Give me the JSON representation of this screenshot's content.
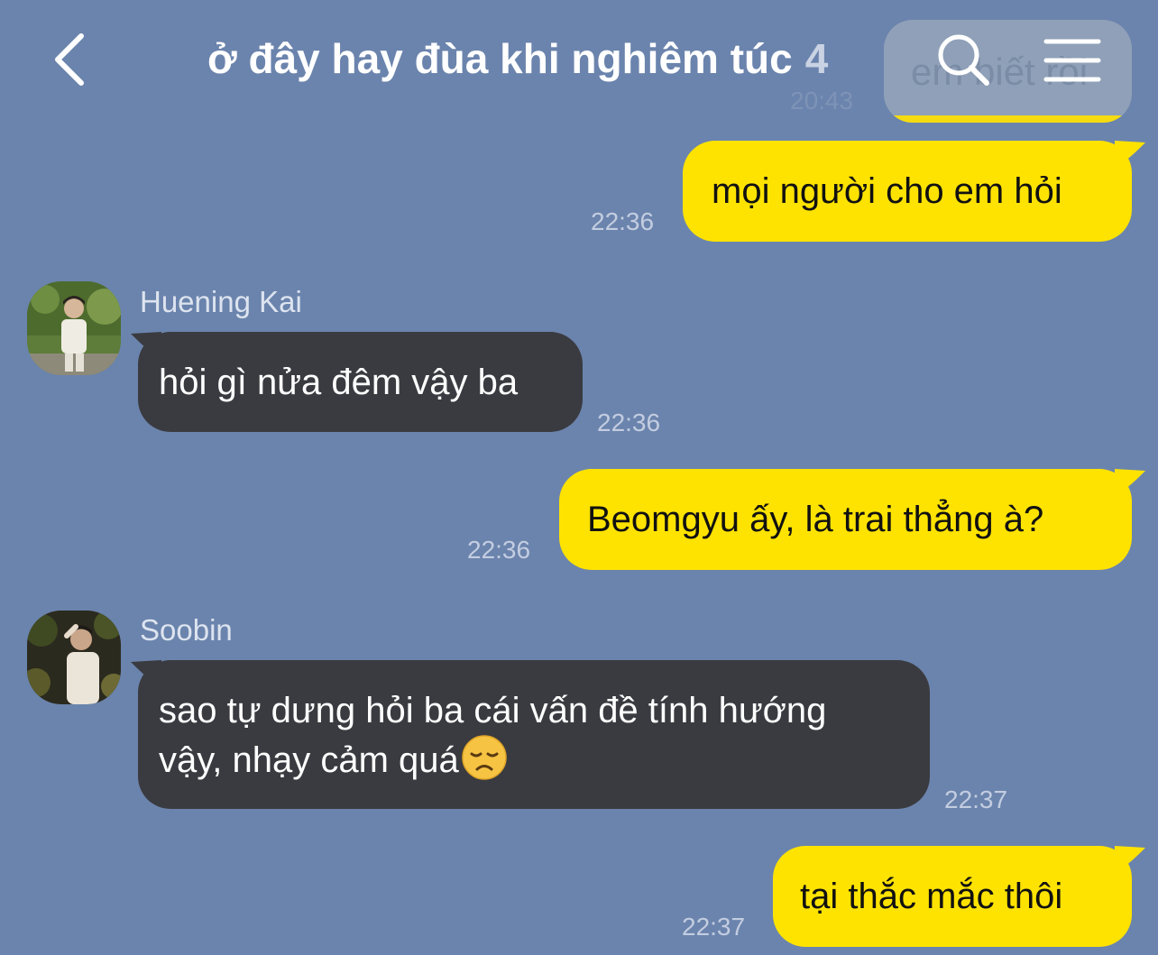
{
  "header": {
    "title": "ở đây hay đùa khi nghiêm túc",
    "member_count": "4",
    "back_icon": "chevron-left-icon",
    "search_icon": "search-icon",
    "menu_icon": "menu-icon"
  },
  "previous": {
    "text": "em biết rồi",
    "time": "20:43"
  },
  "messages": [
    {
      "from": "me",
      "text": "mọi người cho em hỏi",
      "time": "22:36"
    },
    {
      "from": "Huening Kai",
      "text": "hỏi gì nửa đêm vậy ba",
      "time": "22:36"
    },
    {
      "from": "me",
      "text": "Beomgyu ấy, là trai thẳng à?",
      "time": "22:36"
    },
    {
      "from": "Soobin",
      "line1": "sao tự dưng hỏi ba cái vấn đề tính hướng",
      "line2": "vậy, nhạy cảm quá",
      "emoji": "😞",
      "time": "22:37"
    },
    {
      "from": "me",
      "text": "tại thắc mắc thôi",
      "time": "22:37"
    }
  ],
  "colors": {
    "background": "#6b84ad",
    "my_bubble": "#ffe300",
    "their_bubble": "#3a3b40"
  }
}
